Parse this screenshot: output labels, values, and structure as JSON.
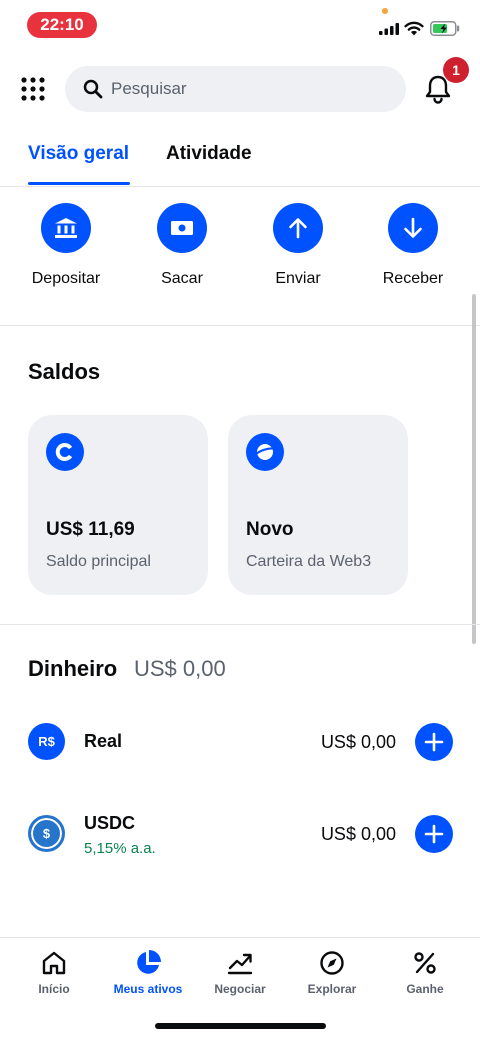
{
  "status": {
    "time": "22:10"
  },
  "search": {
    "placeholder": "Pesquisar"
  },
  "notifications": {
    "count": "1"
  },
  "tabs": [
    {
      "label": "Visão geral",
      "active": true
    },
    {
      "label": "Atividade",
      "active": false
    }
  ],
  "actions": [
    {
      "label": "Depositar",
      "icon": "bank-icon"
    },
    {
      "label": "Sacar",
      "icon": "cash-icon"
    },
    {
      "label": "Enviar",
      "icon": "arrow-up-icon"
    },
    {
      "label": "Receber",
      "icon": "arrow-down-icon"
    }
  ],
  "saldos": {
    "title": "Saldos",
    "cards": [
      {
        "amount": "US$ 11,69",
        "subtitle": "Saldo principal",
        "icon": "coinbase-icon"
      },
      {
        "amount": "Novo",
        "subtitle": "Carteira da Web3",
        "icon": "planet-icon"
      }
    ]
  },
  "dinheiro": {
    "title": "Dinheiro",
    "total": "US$ 0,00",
    "rows": [
      {
        "icon_text": "R$",
        "name": "Real",
        "subtitle": "",
        "amount": "US$ 0,00"
      },
      {
        "icon_text": "$",
        "name": "USDC",
        "subtitle": "5,15% a.a.",
        "amount": "US$ 0,00"
      }
    ]
  },
  "nav": [
    {
      "label": "Início",
      "icon": "home-icon",
      "active": false
    },
    {
      "label": "Meus ativos",
      "icon": "pie-chart-icon",
      "active": true
    },
    {
      "label": "Negociar",
      "icon": "trend-icon",
      "active": false
    },
    {
      "label": "Explorar",
      "icon": "compass-icon",
      "active": false
    },
    {
      "label": "Ganhe",
      "icon": "percent-icon",
      "active": false
    }
  ],
  "colors": {
    "accent": "#0052ff",
    "badge": "#cf202f",
    "positive": "#098551",
    "time_pill": "#e8333e"
  }
}
